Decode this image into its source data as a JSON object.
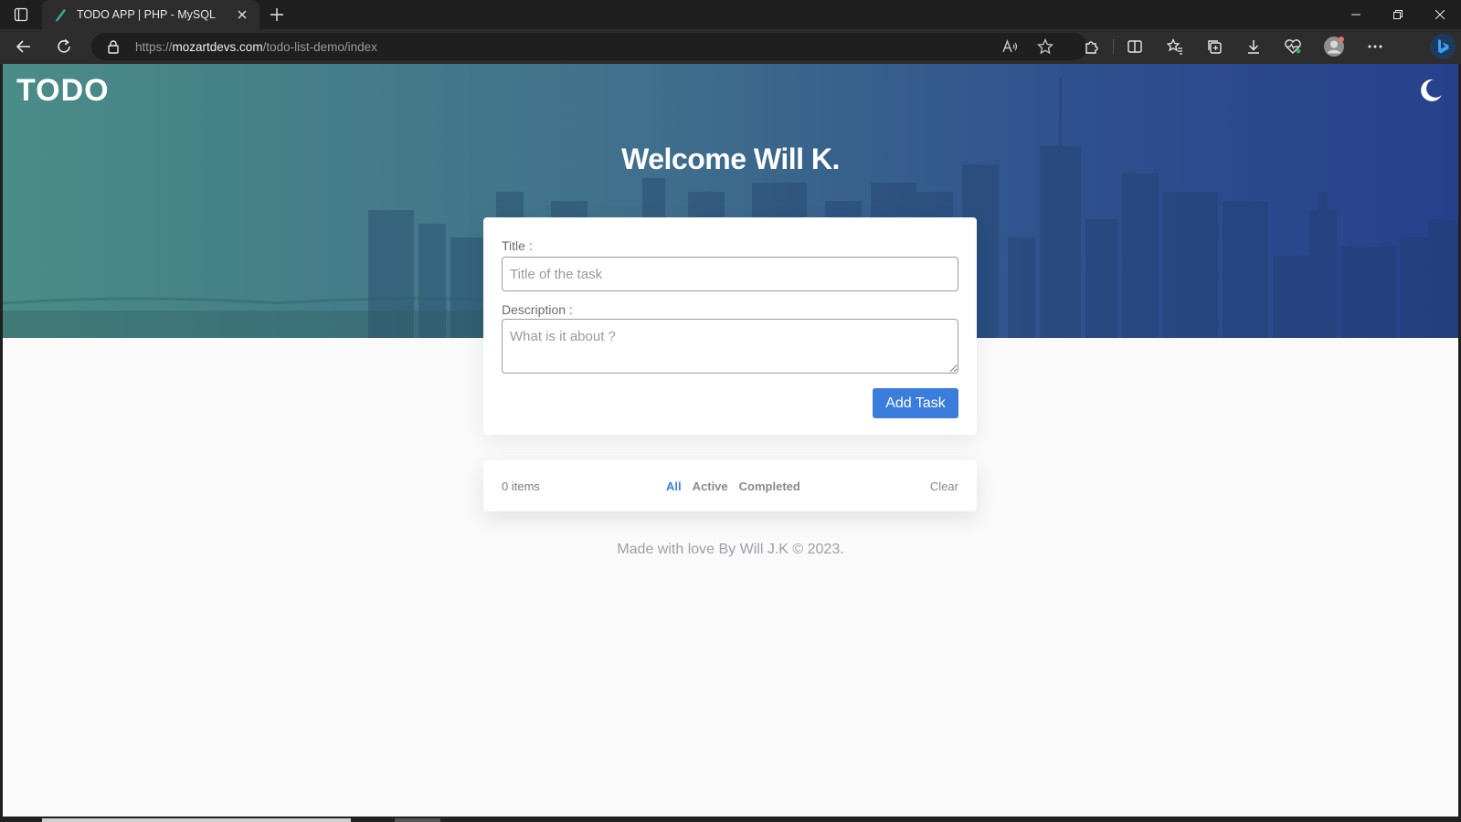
{
  "browser": {
    "tab_title": "TODO APP | PHP - MySQL",
    "url_prefix": "https://",
    "url_host": "mozartdevs.com",
    "url_path": "/todo-list-demo/index"
  },
  "page": {
    "logo": "TODO",
    "welcome": "Welcome Will K.",
    "form": {
      "title_label": "Title :",
      "title_placeholder": "Title of the task",
      "description_label": "Description :",
      "description_placeholder": "What is it about ?",
      "add_button": "Add Task"
    },
    "filters": {
      "count": "0 items",
      "all": "All",
      "active": "Active",
      "completed": "Completed",
      "clear": "Clear",
      "selected": "All"
    },
    "footer": "Made with love By Will J.K © 2023."
  },
  "colors": {
    "accent": "#3b7ddd",
    "hero_start": "#4a8c87",
    "hero_end": "#27408c"
  }
}
